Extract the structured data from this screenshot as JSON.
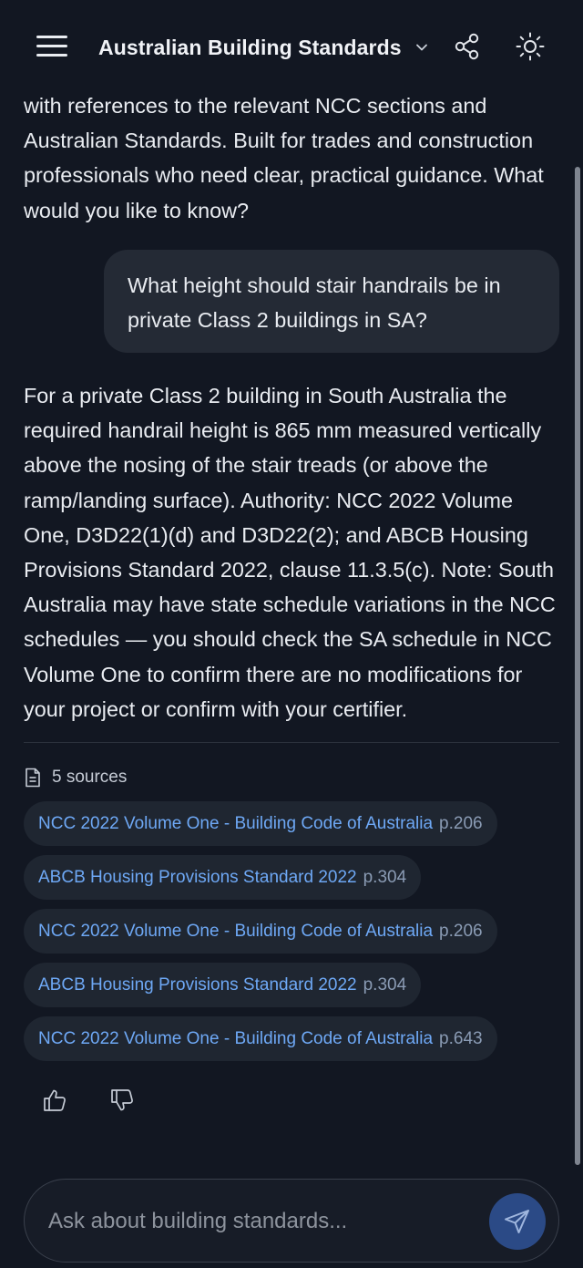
{
  "header": {
    "title": "Australian Building Standards",
    "menu_icon": "hamburger-menu-icon",
    "chevron_icon": "chevron-down-icon",
    "share_icon": "share-icon",
    "theme_icon": "sun-icon"
  },
  "chat": {
    "intro_text": "with references to the relevant NCC sections and Australian Standards. Built for trades and construction professionals who need clear, practical guidance. What would you like to know?",
    "user_message": "What height should stair handrails be in private Class 2 buildings in SA?",
    "assistant_answer": "For a private Class 2 building in South Australia the required handrail height is 865 mm measured vertically above the nosing of the stair treads (or above the ramp/landing surface). Authority: NCC 2022 Volume One, D3D22(1)(d) and D3D22(2); and ABCB Housing Provisions Standard 2022, clause 11.3.5(c). Note: South Australia may have state schedule variations in the NCC schedules — you should check the SA schedule in NCC Volume One to confirm there are no modifications for your project or confirm with your certifier.",
    "sources_label": "5 sources",
    "sources": [
      {
        "name": "NCC 2022 Volume One - Building Code of Australia",
        "page": "p.206"
      },
      {
        "name": "ABCB Housing Provisions Standard 2022",
        "page": "p.304"
      },
      {
        "name": "NCC 2022 Volume One - Building Code of Australia",
        "page": "p.206"
      },
      {
        "name": "ABCB Housing Provisions Standard 2022",
        "page": "p.304"
      },
      {
        "name": "NCC 2022 Volume One - Building Code of Australia",
        "page": "p.643"
      }
    ],
    "feedback_icons": [
      "thumbs-up-icon",
      "thumbs-down-icon"
    ]
  },
  "composer": {
    "placeholder": "Ask about building standards...",
    "value": "",
    "send_icon": "send-icon"
  },
  "colors": {
    "background": "#121722",
    "bubble": "#242a35",
    "link": "#6ea8f5",
    "send_button": "#2b4a86"
  }
}
